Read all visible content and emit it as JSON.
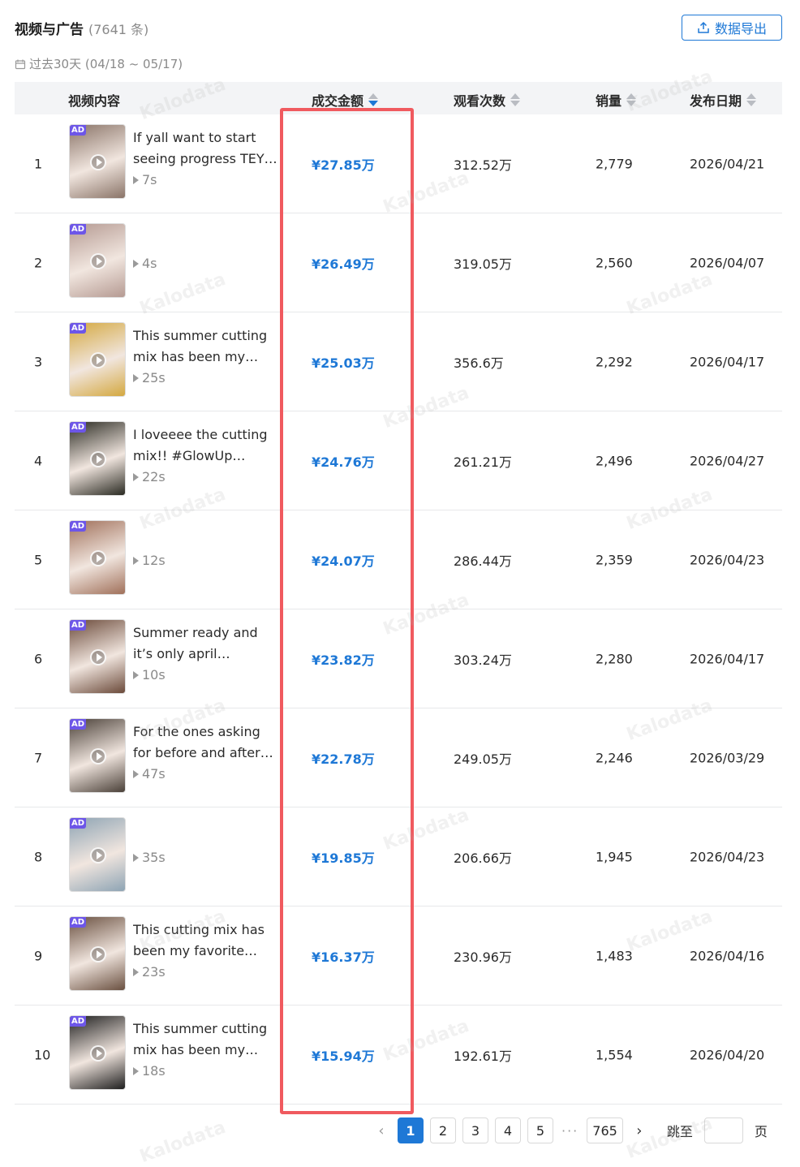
{
  "header": {
    "title": "视频与广告",
    "count": "(7641 条)",
    "export_label": "数据导出"
  },
  "range_label": "过去30天 (04/18 ~ 05/17)",
  "columns": {
    "content": "视频内容",
    "gmv": "成交金额",
    "views": "观看次数",
    "sales": "销量",
    "date": "发布日期"
  },
  "ad_badge": "AD",
  "rows": [
    {
      "rank": "1",
      "title": "If yall want to start seeing progress TEY…",
      "duration": "7s",
      "gmv": "¥27.85万",
      "views": "312.52万",
      "sales": "2,779",
      "date": "2026/04/21",
      "thumb_color": "#8a7468"
    },
    {
      "rank": "2",
      "title": "",
      "duration": "4s",
      "gmv": "¥26.49万",
      "views": "319.05万",
      "sales": "2,560",
      "date": "2026/04/07",
      "thumb_color": "#b59a92"
    },
    {
      "rank": "3",
      "title": "This summer cutting mix has been my…",
      "duration": "25s",
      "gmv": "¥25.03万",
      "views": "356.6万",
      "sales": "2,292",
      "date": "2026/04/17",
      "thumb_color": "#d4a840"
    },
    {
      "rank": "4",
      "title": "I loveeee the cutting mix!! #GlowUp…",
      "duration": "22s",
      "gmv": "¥24.76万",
      "views": "261.21万",
      "sales": "2,496",
      "date": "2026/04/27",
      "thumb_color": "#2a2a22"
    },
    {
      "rank": "5",
      "title": "",
      "duration": "12s",
      "gmv": "¥24.07万",
      "views": "286.44万",
      "sales": "2,359",
      "date": "2026/04/23",
      "thumb_color": "#a0705a"
    },
    {
      "rank": "6",
      "title": "Summer ready and it’s only april #GlowUp…",
      "duration": "10s",
      "gmv": "¥23.82万",
      "views": "303.24万",
      "sales": "2,280",
      "date": "2026/04/17",
      "thumb_color": "#6b4a3a"
    },
    {
      "rank": "7",
      "title": "For the ones asking for before and after…",
      "duration": "47s",
      "gmv": "¥22.78万",
      "views": "249.05万",
      "sales": "2,246",
      "date": "2026/03/29",
      "thumb_color": "#4a4038"
    },
    {
      "rank": "8",
      "title": "",
      "duration": "35s",
      "gmv": "¥19.85万",
      "views": "206.66万",
      "sales": "1,945",
      "date": "2026/04/23",
      "thumb_color": "#8ea4b4"
    },
    {
      "rank": "9",
      "title": "This cutting mix has been my favorite…",
      "duration": "23s",
      "gmv": "¥16.37万",
      "views": "230.96万",
      "sales": "1,483",
      "date": "2026/04/16",
      "thumb_color": "#6a5040"
    },
    {
      "rank": "10",
      "title": "This summer cutting mix has been my…",
      "duration": "18s",
      "gmv": "¥15.94万",
      "views": "192.61万",
      "sales": "1,554",
      "date": "2026/04/20",
      "thumb_color": "#1e1e1e"
    }
  ],
  "pagination": {
    "pages": [
      "1",
      "2",
      "3",
      "4",
      "5"
    ],
    "ellipsis": "···",
    "last": "765",
    "jump_label": "跳至",
    "page_suffix": "页",
    "active_color": "#1e78d6"
  },
  "watermark": "Kalodata"
}
